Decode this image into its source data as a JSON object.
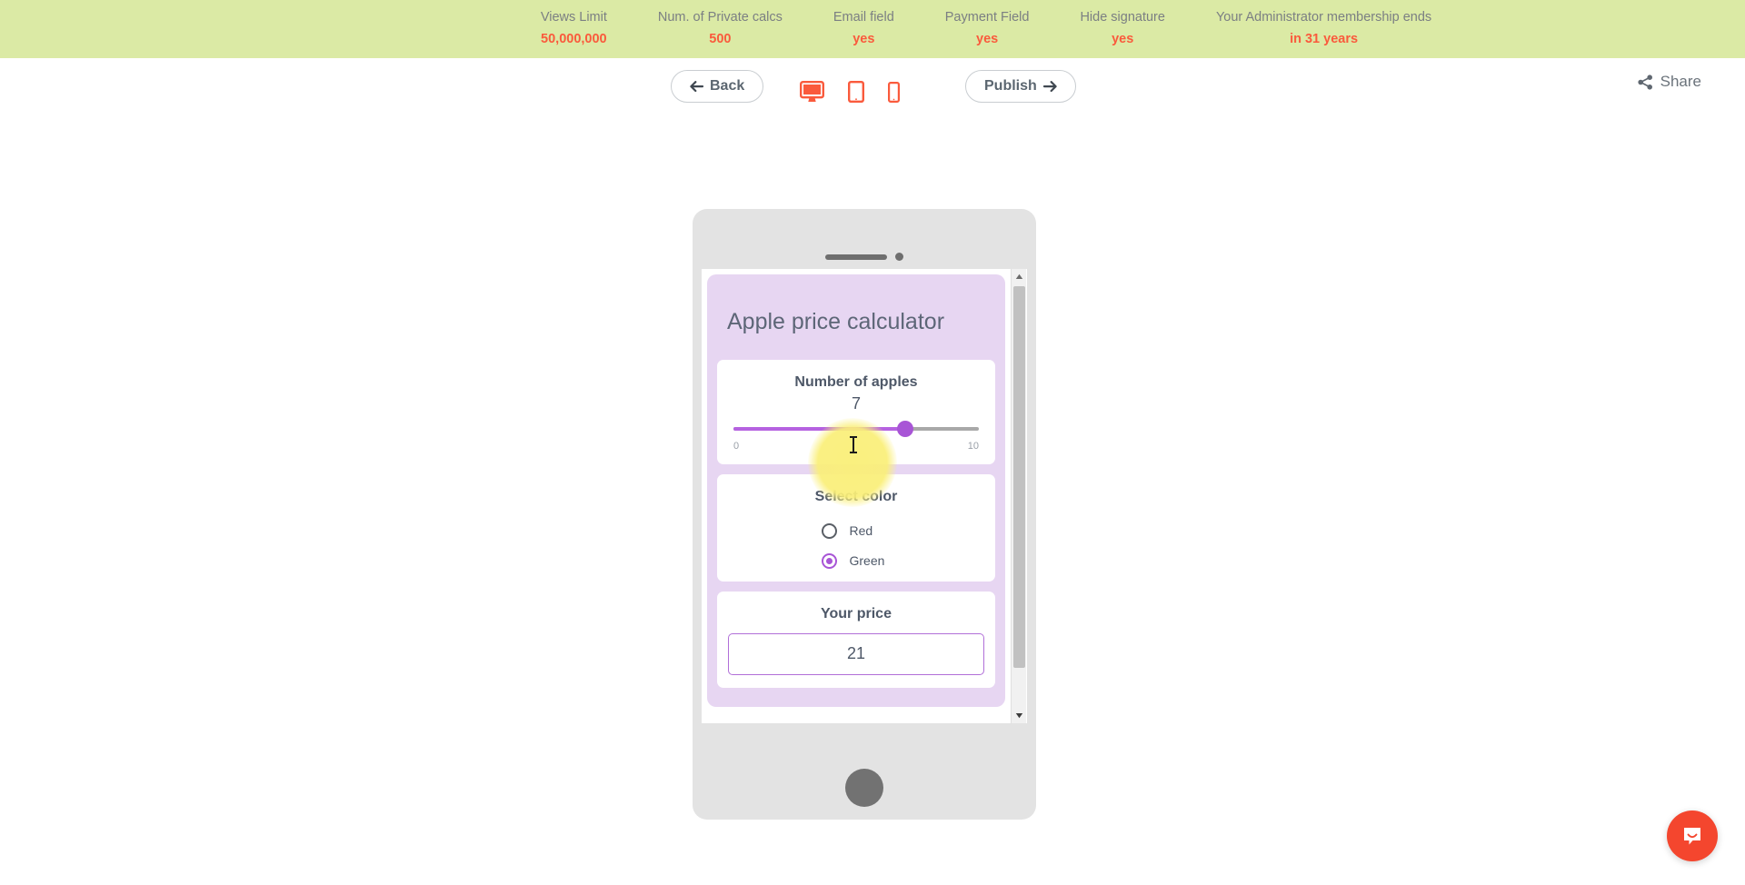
{
  "topbar": {
    "stats": [
      {
        "label": "Views Limit",
        "value": "50,000,000"
      },
      {
        "label": "Num. of Private calcs",
        "value": "500"
      },
      {
        "label": "Email field",
        "value": "yes"
      },
      {
        "label": "Payment Field",
        "value": "yes"
      },
      {
        "label": "Hide signature",
        "value": "yes"
      },
      {
        "label": "Your Administrator membership ends",
        "value": "in 31 years"
      }
    ],
    "background_color": "#dbeaa5",
    "label_color": "#7b7f83",
    "value_color": "#fa5a3c"
  },
  "toolbar": {
    "back_label": "Back",
    "publish_label": "Publish",
    "share_label": "Share",
    "devices": [
      {
        "name": "desktop-preview",
        "icon": "desktop-icon",
        "active": true
      },
      {
        "name": "tablet-preview",
        "icon": "tablet-icon",
        "active": false
      },
      {
        "name": "mobile-preview",
        "icon": "mobile-icon",
        "active": false
      }
    ],
    "device_icon_color": "#fa5a3c"
  },
  "preview": {
    "device": "mobile",
    "app_title": "Apple price calculator",
    "header_background": "#e7d6f2",
    "fields": {
      "slider": {
        "title": "Number of apples",
        "value": "7",
        "min_label": "0",
        "max_label": "10",
        "min": 0,
        "max": 10,
        "fill_color": "#b562e0",
        "track_color": "#a8a8a8"
      },
      "radio": {
        "title": "Select color",
        "options": [
          {
            "label": "Red",
            "selected": false
          },
          {
            "label": "Green",
            "selected": true
          }
        ],
        "selected_color": "#a855d6"
      },
      "result": {
        "title": "Your price",
        "value": "21",
        "border_color": "#b16fd8"
      }
    }
  },
  "widgets": {
    "chat_icon": "chat-bubble-icon",
    "chat_color": "#f4462e"
  }
}
